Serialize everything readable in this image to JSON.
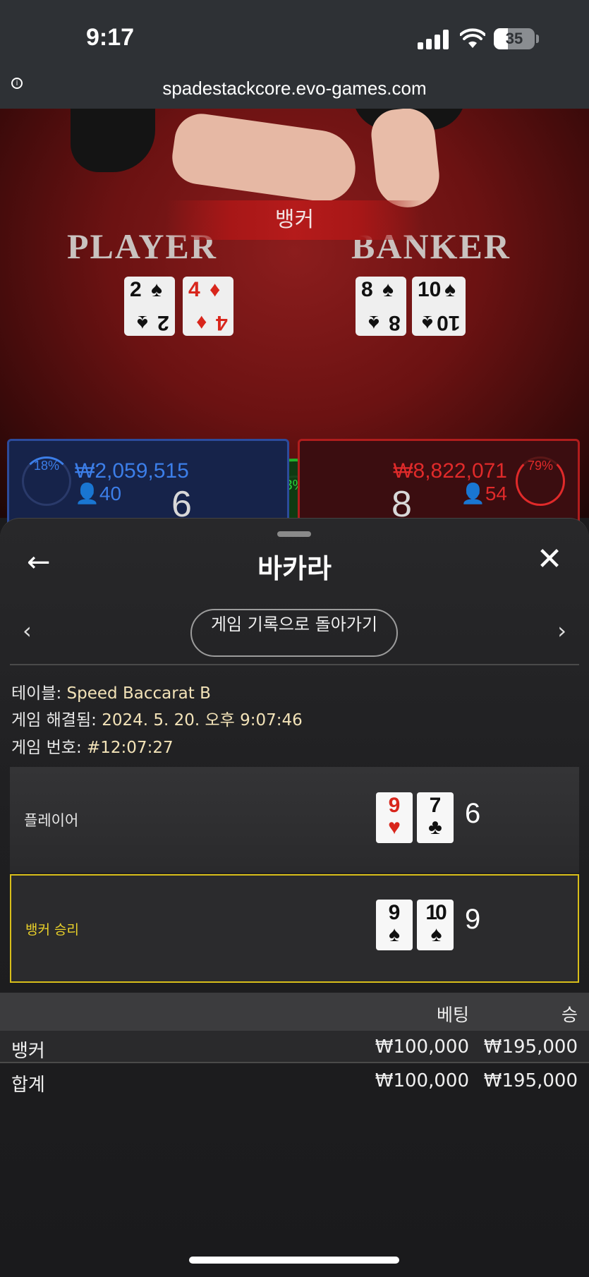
{
  "status": {
    "time": "9:17",
    "battery": "35"
  },
  "browser": {
    "url": "spadestackcore.evo-games.com"
  },
  "stream": {
    "banner": "뱅커",
    "player_label": "PLAYER",
    "banker_label": "BANKER",
    "player_cards": [
      {
        "rank": "2",
        "suit": "♠",
        "color": "black"
      },
      {
        "rank": "4",
        "suit": "♦",
        "color": "red"
      }
    ],
    "banker_cards": [
      {
        "rank": "8",
        "suit": "♠",
        "color": "black"
      },
      {
        "rank": "10",
        "suit": "♠",
        "color": "black"
      }
    ],
    "player_bet": {
      "percent": "18%",
      "amount": "₩2,059,515",
      "players": "40",
      "score": "6"
    },
    "banker_bet": {
      "percent": "79%",
      "amount": "₩8,822,071",
      "players": "54",
      "score": "8"
    },
    "tie_percent": "3%"
  },
  "sheet": {
    "title": "바카라",
    "back_label": "←",
    "close_label": "✕",
    "prev_label": "‹",
    "next_label": "›",
    "history_button": "게임 기록으로 돌아가기",
    "table_label": "테이블:",
    "table_value": "Speed Baccarat B",
    "resolved_label": "게임 해결됨:",
    "resolved_value": "2024. 5. 20. 오후 9:07:46",
    "game_no_label": "게임 번호:",
    "game_no_value": "#12:07:27",
    "player_row": {
      "label": "플레이어",
      "cards": [
        {
          "rank": "9",
          "suit": "♥",
          "color": "red"
        },
        {
          "rank": "7",
          "suit": "♣",
          "color": "black"
        }
      ],
      "score": "6"
    },
    "banker_row": {
      "label": "뱅커 승리",
      "cards": [
        {
          "rank": "9",
          "suit": "♠",
          "color": "black"
        },
        {
          "rank": "10",
          "suit": "♠",
          "color": "black"
        }
      ],
      "score": "9"
    },
    "bets_table": {
      "col_bet": "베팅",
      "col_win": "승",
      "rows": [
        {
          "name": "뱅커",
          "bet": "₩100,000",
          "win": "₩195,000"
        },
        {
          "name": "합계",
          "bet": "₩100,000",
          "win": "₩195,000"
        }
      ]
    }
  },
  "colors": {
    "player_blue": "#3c7ee8",
    "banker_red": "#e02a2a",
    "tie_green": "#22b12c",
    "winner_highlight": "#d8be1a"
  }
}
